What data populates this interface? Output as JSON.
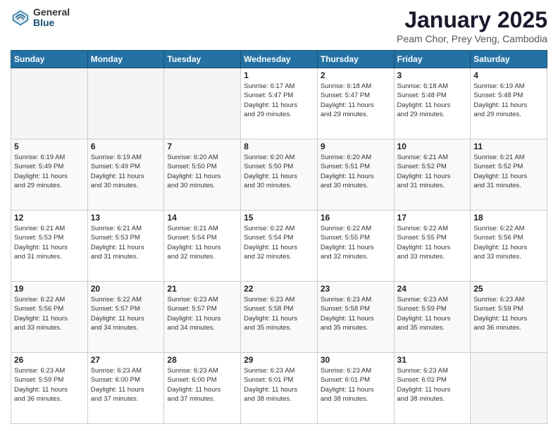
{
  "header": {
    "logo_general": "General",
    "logo_blue": "Blue",
    "month_title": "January 2025",
    "location": "Peam Chor, Prey Veng, Cambodia"
  },
  "days_of_week": [
    "Sunday",
    "Monday",
    "Tuesday",
    "Wednesday",
    "Thursday",
    "Friday",
    "Saturday"
  ],
  "weeks": [
    [
      {
        "day": "",
        "info": ""
      },
      {
        "day": "",
        "info": ""
      },
      {
        "day": "",
        "info": ""
      },
      {
        "day": "1",
        "info": "Sunrise: 6:17 AM\nSunset: 5:47 PM\nDaylight: 11 hours\nand 29 minutes."
      },
      {
        "day": "2",
        "info": "Sunrise: 6:18 AM\nSunset: 5:47 PM\nDaylight: 11 hours\nand 29 minutes."
      },
      {
        "day": "3",
        "info": "Sunrise: 6:18 AM\nSunset: 5:48 PM\nDaylight: 11 hours\nand 29 minutes."
      },
      {
        "day": "4",
        "info": "Sunrise: 6:19 AM\nSunset: 5:48 PM\nDaylight: 11 hours\nand 29 minutes."
      }
    ],
    [
      {
        "day": "5",
        "info": "Sunrise: 6:19 AM\nSunset: 5:49 PM\nDaylight: 11 hours\nand 29 minutes."
      },
      {
        "day": "6",
        "info": "Sunrise: 6:19 AM\nSunset: 5:49 PM\nDaylight: 11 hours\nand 30 minutes."
      },
      {
        "day": "7",
        "info": "Sunrise: 6:20 AM\nSunset: 5:50 PM\nDaylight: 11 hours\nand 30 minutes."
      },
      {
        "day": "8",
        "info": "Sunrise: 6:20 AM\nSunset: 5:50 PM\nDaylight: 11 hours\nand 30 minutes."
      },
      {
        "day": "9",
        "info": "Sunrise: 6:20 AM\nSunset: 5:51 PM\nDaylight: 11 hours\nand 30 minutes."
      },
      {
        "day": "10",
        "info": "Sunrise: 6:21 AM\nSunset: 5:52 PM\nDaylight: 11 hours\nand 31 minutes."
      },
      {
        "day": "11",
        "info": "Sunrise: 6:21 AM\nSunset: 5:52 PM\nDaylight: 11 hours\nand 31 minutes."
      }
    ],
    [
      {
        "day": "12",
        "info": "Sunrise: 6:21 AM\nSunset: 5:53 PM\nDaylight: 11 hours\nand 31 minutes."
      },
      {
        "day": "13",
        "info": "Sunrise: 6:21 AM\nSunset: 5:53 PM\nDaylight: 11 hours\nand 31 minutes."
      },
      {
        "day": "14",
        "info": "Sunrise: 6:21 AM\nSunset: 5:54 PM\nDaylight: 11 hours\nand 32 minutes."
      },
      {
        "day": "15",
        "info": "Sunrise: 6:22 AM\nSunset: 5:54 PM\nDaylight: 11 hours\nand 32 minutes."
      },
      {
        "day": "16",
        "info": "Sunrise: 6:22 AM\nSunset: 5:55 PM\nDaylight: 11 hours\nand 32 minutes."
      },
      {
        "day": "17",
        "info": "Sunrise: 6:22 AM\nSunset: 5:55 PM\nDaylight: 11 hours\nand 33 minutes."
      },
      {
        "day": "18",
        "info": "Sunrise: 6:22 AM\nSunset: 5:56 PM\nDaylight: 11 hours\nand 33 minutes."
      }
    ],
    [
      {
        "day": "19",
        "info": "Sunrise: 6:22 AM\nSunset: 5:56 PM\nDaylight: 11 hours\nand 33 minutes."
      },
      {
        "day": "20",
        "info": "Sunrise: 6:22 AM\nSunset: 5:57 PM\nDaylight: 11 hours\nand 34 minutes."
      },
      {
        "day": "21",
        "info": "Sunrise: 6:23 AM\nSunset: 5:57 PM\nDaylight: 11 hours\nand 34 minutes."
      },
      {
        "day": "22",
        "info": "Sunrise: 6:23 AM\nSunset: 5:58 PM\nDaylight: 11 hours\nand 35 minutes."
      },
      {
        "day": "23",
        "info": "Sunrise: 6:23 AM\nSunset: 5:58 PM\nDaylight: 11 hours\nand 35 minutes."
      },
      {
        "day": "24",
        "info": "Sunrise: 6:23 AM\nSunset: 5:59 PM\nDaylight: 11 hours\nand 35 minutes."
      },
      {
        "day": "25",
        "info": "Sunrise: 6:23 AM\nSunset: 5:59 PM\nDaylight: 11 hours\nand 36 minutes."
      }
    ],
    [
      {
        "day": "26",
        "info": "Sunrise: 6:23 AM\nSunset: 5:59 PM\nDaylight: 11 hours\nand 36 minutes."
      },
      {
        "day": "27",
        "info": "Sunrise: 6:23 AM\nSunset: 6:00 PM\nDaylight: 11 hours\nand 37 minutes."
      },
      {
        "day": "28",
        "info": "Sunrise: 6:23 AM\nSunset: 6:00 PM\nDaylight: 11 hours\nand 37 minutes."
      },
      {
        "day": "29",
        "info": "Sunrise: 6:23 AM\nSunset: 6:01 PM\nDaylight: 11 hours\nand 38 minutes."
      },
      {
        "day": "30",
        "info": "Sunrise: 6:23 AM\nSunset: 6:01 PM\nDaylight: 11 hours\nand 38 minutes."
      },
      {
        "day": "31",
        "info": "Sunrise: 6:23 AM\nSunset: 6:02 PM\nDaylight: 11 hours\nand 38 minutes."
      },
      {
        "day": "",
        "info": ""
      }
    ]
  ]
}
